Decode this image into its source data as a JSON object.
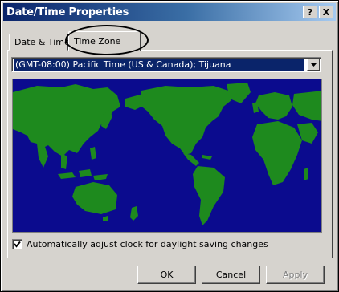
{
  "window": {
    "title": "Date/Time Properties",
    "help_button": "?",
    "close_button": "X"
  },
  "tabs": [
    {
      "label": "Date & Time",
      "active": false
    },
    {
      "label": "Time Zone",
      "active": true
    }
  ],
  "timezone": {
    "selected": "(GMT-08:00) Pacific Time (US & Canada); Tijuana"
  },
  "map": {
    "ocean_color": "#0b0b8e",
    "land_color": "#1e8a1e"
  },
  "dst": {
    "checked": true,
    "label": "Automatically adjust clock for daylight saving changes"
  },
  "buttons": {
    "ok": "OK",
    "cancel": "Cancel",
    "apply": "Apply"
  },
  "colors": {
    "titlebar_start": "#0a246a",
    "face": "#d6d3ce",
    "selection": "#0a246a"
  }
}
